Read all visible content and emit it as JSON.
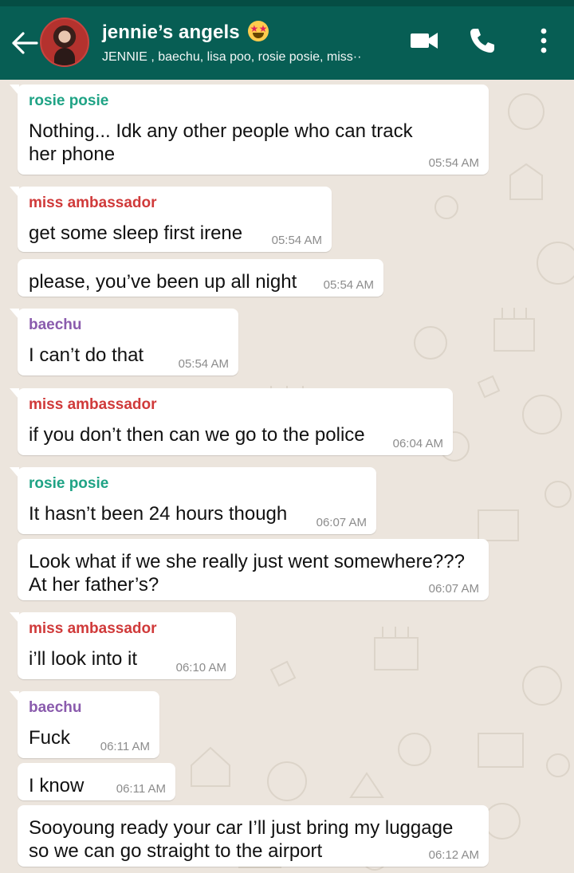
{
  "header": {
    "title": "jennie’s angels",
    "subtitle": "JENNIE , baechu, lisa poo, rosie posie, miss··",
    "colors": {
      "bar": "#075E54",
      "status": "#054D44"
    },
    "icons": [
      "back-arrow-icon",
      "video-call-icon",
      "phone-icon",
      "more-options-icon",
      "star-struck-emoji-icon"
    ]
  },
  "chat": {
    "wallpaper": "#ECE5DD",
    "messages": [
      {
        "sender": "rosie posie",
        "sender_color": "#1FA385",
        "lines": [
          "Nothing... Idk any other people who can track",
          "her phone"
        ],
        "time": "05:54 AM"
      },
      {
        "sender": "miss ambassador",
        "sender_color": "#D03A3A",
        "lines": [
          "get some sleep first irene"
        ],
        "time": "05:54 AM"
      },
      {
        "sender": "",
        "lines": [
          "please, you’ve been up all night"
        ],
        "time": "05:54 AM"
      },
      {
        "sender": "baechu",
        "sender_color": "#8A5BAD",
        "lines": [
          "I can’t do that"
        ],
        "time": "05:54 AM"
      },
      {
        "sender": "miss ambassador",
        "sender_color": "#D03A3A",
        "lines": [
          "if you don’t then can we go to the police"
        ],
        "time": "06:04 AM"
      },
      {
        "sender": "rosie posie",
        "sender_color": "#1FA385",
        "lines": [
          "It hasn’t been 24 hours though"
        ],
        "time": "06:07 AM"
      },
      {
        "sender": "",
        "lines": [
          "Look what if we she really just went somewhere???",
          "At her father’s?"
        ],
        "time": "06:07 AM"
      },
      {
        "sender": "miss ambassador",
        "sender_color": "#D03A3A",
        "lines": [
          "i’ll look into it"
        ],
        "time": "06:10 AM"
      },
      {
        "sender": "baechu",
        "sender_color": "#8A5BAD",
        "lines": [
          "Fuck"
        ],
        "time": "06:11 AM"
      },
      {
        "sender": "",
        "lines": [
          "I know"
        ],
        "time": "06:11 AM"
      },
      {
        "sender": "",
        "lines": [
          "Sooyoung ready your car I’ll just bring my luggage",
          "so we can go straight to the airport"
        ],
        "time": "06:12 AM"
      }
    ]
  }
}
